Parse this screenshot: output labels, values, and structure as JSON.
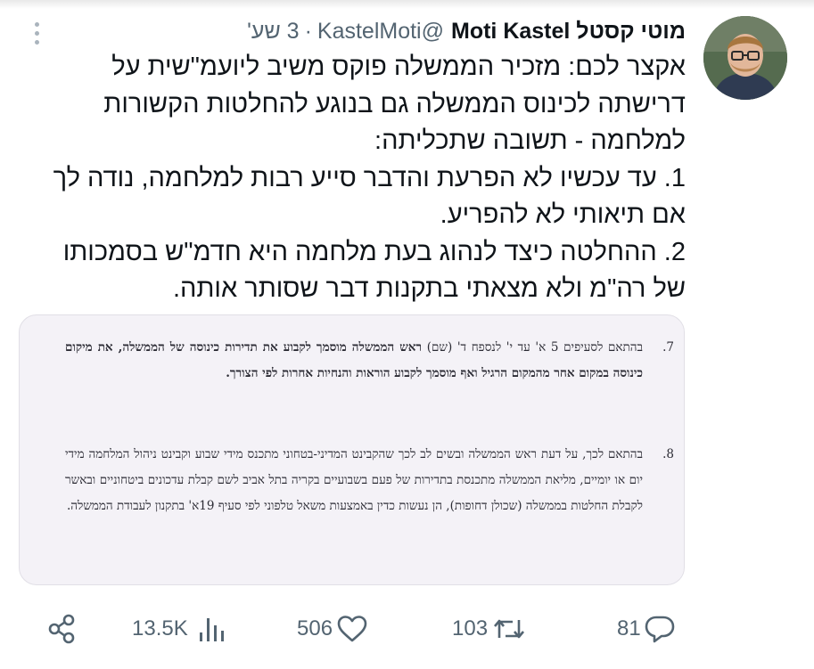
{
  "tweet": {
    "display_name": "מוטי קסטל Moti Kastel",
    "handle": "@KastelMoti",
    "separator": "·",
    "time": "3 שע'",
    "text_lines": [
      "אקצר לכם: מזכיר הממשלה פוקס משיב ליועמ\"שית על דרישתה לכינוס הממשלה גם בנוגע להחלטות הקשורות למלחמה - תשובה שתכליתה:",
      "1. עד עכשיו לא הפרעת והדבר סייע רבות למלחמה, נודה לך אם תיאותי לא להפריע.",
      "2. ההחלטה כיצד לנהוג בעת מלחמה היא חדמ\"ש בסמכותו של רה\"מ ולא מצאתי בתקנות דבר שסותר אותה."
    ]
  },
  "document_image": {
    "clause_7": {
      "number": "7.",
      "intro": "בהתאם לסעיפים 5 א' עד י' לנספח ד' (שם) ",
      "bold": "ראש הממשלה מוסמך לקבוע את תדירות כינוסה של הממשלה, את מיקום כינוסה במקום אחר מהמקום הרגיל ואף מוסמך לקבוע הוראות והנחיות אחרות לפי הצורך."
    },
    "clause_8": {
      "number": "8.",
      "text": "בהתאם לכך, על דעת ראש הממשלה ובשים לב לכך שהקבינט המדיני-בטחוני מתכנס מידי שבוע וקבינט ניהול המלחמה מידי יום או יומיים, מליאת הממשלה מתכנסת בתדירות של פעם בשבועיים בקריה בתל אביב לשם קבלת עדכונים ביטחוניים ובאשר לקבלת החלטות בממשלה (שכולן דחופות), הן נעשות כדין באמצעות משאל טלפוני לפי סעיף 19א' בתקנון לעבודת הממשלה."
    }
  },
  "actions": {
    "replies": "81",
    "retweets": "103",
    "likes": "506",
    "views": "13.5K",
    "share_icon": "share-icon",
    "views_icon": "views-icon",
    "like_icon": "heart-icon",
    "retweet_icon": "retweet-icon",
    "reply_icon": "reply-icon"
  },
  "colors": {
    "text": "#0f1419",
    "secondary": "#536471",
    "card_bg": "#f4f2f7"
  }
}
